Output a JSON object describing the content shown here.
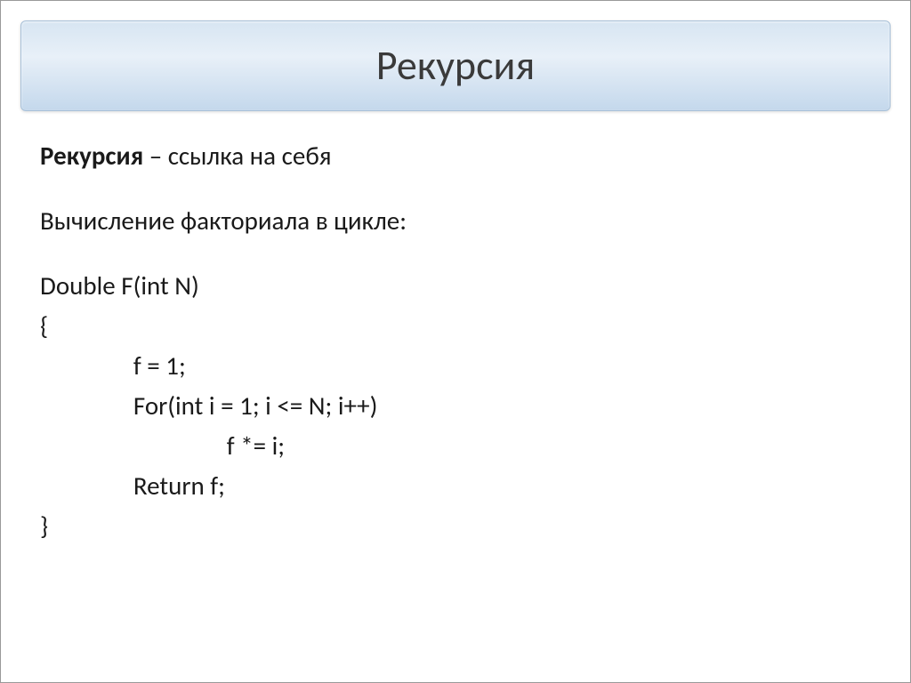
{
  "title": "Рекурсия",
  "definition": {
    "term": "Рекурсия",
    "separator": " – ",
    "description": "ссылка на себя"
  },
  "section_heading": "Вычисление факториала в цикле:",
  "code": {
    "line1": "Double F(int N)",
    "line2": "{",
    "line3": "                f = 1;",
    "line4": "                For(int i = 1; i <= N; i++)",
    "line5": "                                f *= i;",
    "line6": "                Return f;",
    "line7": "}"
  }
}
